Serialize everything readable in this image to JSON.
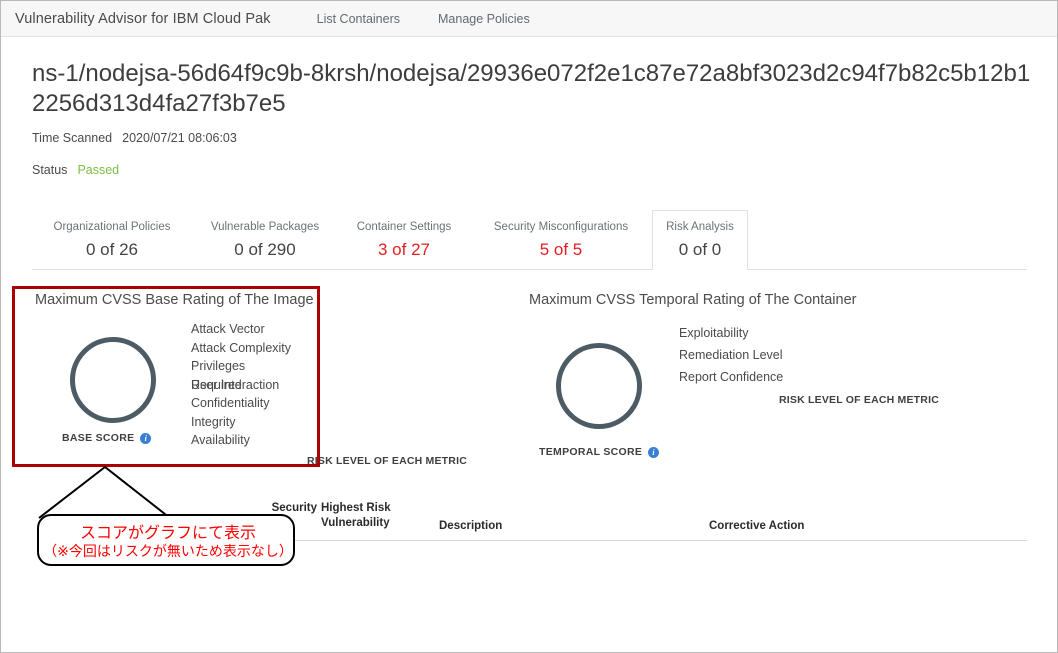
{
  "nav": {
    "brand": "Vulnerability Advisor for IBM Cloud Pak",
    "links": [
      {
        "label": "List Containers"
      },
      {
        "label": "Manage Policies"
      }
    ]
  },
  "header": {
    "title": "ns-1/nodejsa-56d64f9c9b-8krsh/nodejsa/29936e072f2e1c87e72a8bf3023d2c94f7b82c5b12b12256d313d4fa27f3b7e5",
    "time_scanned_label": "Time Scanned",
    "time_scanned_value": "2020/07/21 08:06:03",
    "status_label": "Status",
    "status_value": "Passed",
    "status_color": "#7bc043"
  },
  "tabs": [
    {
      "label": "Organizational Policies",
      "count": "0 of 26",
      "warn": false,
      "active": false
    },
    {
      "label": "Vulnerable Packages",
      "count": "0 of 290",
      "warn": false,
      "active": false
    },
    {
      "label": "Container Settings",
      "count": "3 of 27",
      "warn": true,
      "active": false
    },
    {
      "label": "Security Misconfigurations",
      "count": "5 of 5",
      "warn": true,
      "active": false
    },
    {
      "label": "Risk Analysis",
      "count": "0 of 0",
      "warn": false,
      "active": true
    }
  ],
  "base_panel": {
    "title": "Maximum CVSS Base Rating of The Image",
    "score_caption": "BASE SCORE",
    "info_icon": "info-icon",
    "score_value": "",
    "metrics": [
      "Attack Vector",
      "Attack Complexity",
      "Privileges",
      "Required",
      "User Interaction",
      "Confidentiality",
      "Integrity",
      "Availability"
    ],
    "legend": "RISK LEVEL OF EACH METRIC"
  },
  "temporal_panel": {
    "title": "Maximum CVSS Temporal Rating of The Container",
    "score_caption": "TEMPORAL SCORE",
    "info_icon": "info-icon",
    "score_value": "",
    "metrics": [
      "Exploitability",
      "Remediation Level",
      "Report Confidence"
    ],
    "legend": "RISK LEVEL OF EACH METRIC"
  },
  "annotation": {
    "line1": "スコアがグラフにて表示",
    "line2": "（※今回はリスクが無いため表示なし）",
    "text_color": "#ff0000",
    "highlight_color": "#aa0000"
  },
  "results_table": {
    "columns": [
      "Security",
      "Highest Risk",
      "Vulnerability",
      "Description",
      "Corrective Action"
    ],
    "rows": []
  }
}
